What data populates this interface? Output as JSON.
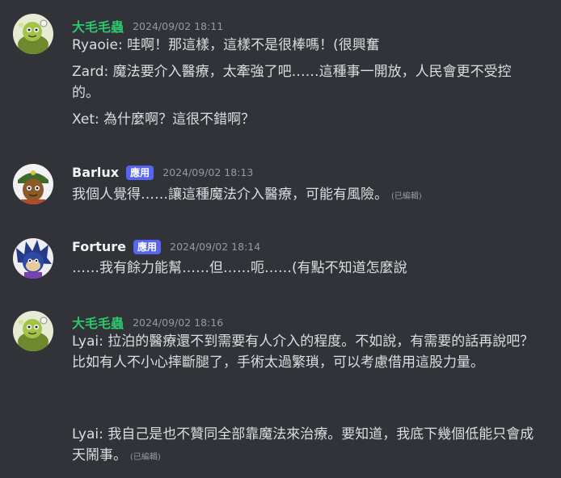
{
  "colors": {
    "background": "#313338",
    "username_green": "#2dc770",
    "username_white": "#f2f3f5",
    "app_tag": "#5865f2",
    "timestamp": "#949ba4",
    "text": "#dbdee1"
  },
  "messages": [
    {
      "username": "大毛毛蟲",
      "timestamp": "2024/09/02 18:11",
      "avatar_icon": "green-creature-avatar-icon",
      "lines": [
        "Ryaoie: 哇啊！那這樣，這樣不是很棒嗎！(很興奮",
        "Zard: 魔法要介入醫療，太牽強了吧……這種事一開放，人民會更不受控的。",
        "Xet: 為什麼啊？這很不錯啊？"
      ]
    },
    {
      "username": "Barlux",
      "app_tag": "應用",
      "timestamp": "2024/09/02 18:13",
      "avatar_icon": "soldier-character-avatar-icon",
      "lines": [
        "我個人覺得……讓這種魔法介入醫療，可能有風險。"
      ],
      "edited": "(已編輯)"
    },
    {
      "username": "Forture",
      "app_tag": "應用",
      "timestamp": "2024/09/02 18:14",
      "avatar_icon": "blue-hedgehog-avatar-icon",
      "lines": [
        "……我有餘力能幫……但……呃……(有點不知道怎麼說"
      ]
    },
    {
      "username": "大毛毛蟲",
      "timestamp": "2024/09/02 18:16",
      "avatar_icon": "green-creature-avatar-icon",
      "lines": [
        "Lyai: 拉泊的醫療還不到需要有人介入的程度。不如說，有需要的話再說吧？\n比如有人不小心摔斷腿了，手術太過繁瑣，可以考慮借用這股力量。",
        "Lyai: 我自己是也不贊同全部靠魔法來治療。要知道，我底下幾個低能只會成天鬧事。"
      ],
      "edited": "(已編輯)"
    }
  ]
}
